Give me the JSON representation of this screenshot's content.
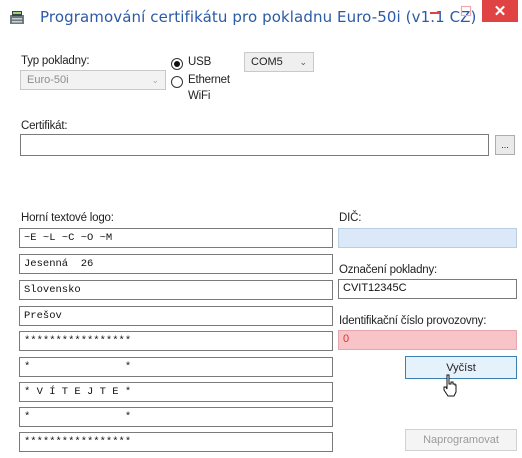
{
  "window": {
    "title": "Programování certifikátu pro pokladnu Euro-50i (v1.1 CZ)",
    "close_glyph": "✕",
    "accent_color": "#2b5aa6",
    "close_color": "#e04343"
  },
  "register": {
    "type_label": "Typ pokladny:",
    "type_value": "Euro-50i"
  },
  "connection": {
    "usb_label": "USB",
    "ethernet_label": "Ethernet",
    "wifi_label": "WiFi",
    "selected": "USB",
    "port_value": "COM5"
  },
  "certificate": {
    "label": "Certifikát:",
    "value": "",
    "browse_label": "..."
  },
  "logo": {
    "label": "Horní textové logo:",
    "lines": [
      "~E ~L ~C ~O ~M",
      "Jesenná  26",
      "Slovensko",
      "Prešov",
      "*****************",
      "*               *",
      "* V Í T E J T E *",
      "*               *",
      "*****************"
    ]
  },
  "right": {
    "dic_label": "DIČ:",
    "dic_value": "",
    "register_id_label": "Označení pokladny:",
    "register_id_value": "CVIT12345C",
    "premises_label": "Identifikační číslo provozovny:",
    "premises_value": "0",
    "read_button": "Vyčíst",
    "program_button": "Naprogramovat"
  },
  "colors": {
    "dic_bg": "#dbe8f7",
    "premises_bg": "#f8c4c8"
  }
}
